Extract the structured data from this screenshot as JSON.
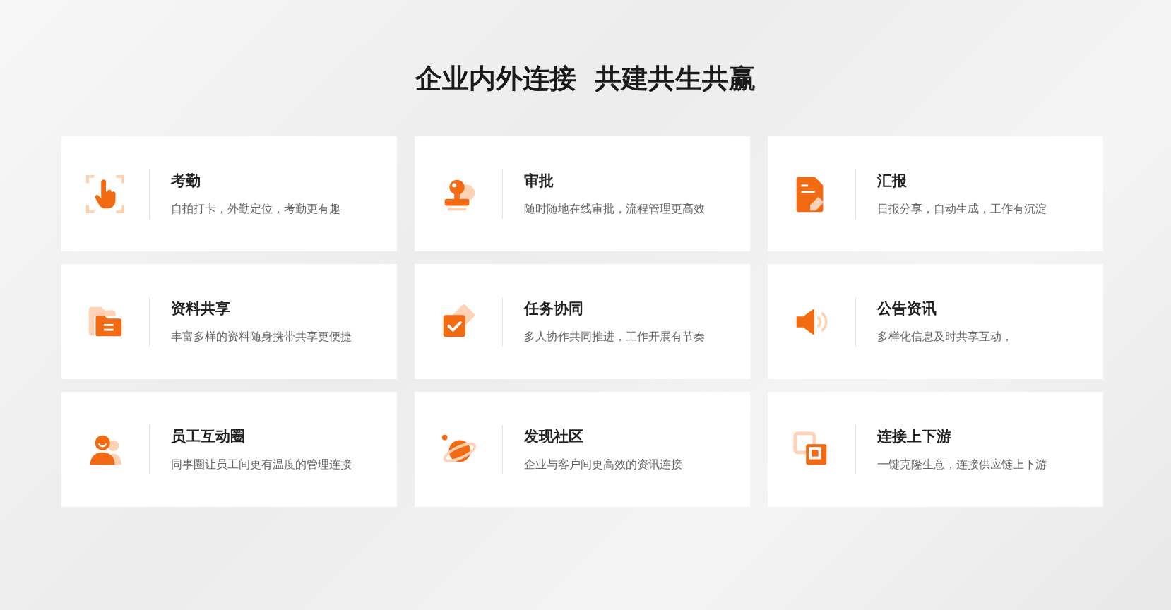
{
  "heading": "企业内外连接  共建共生共赢",
  "features": [
    {
      "kind": "hand",
      "title": "考勤",
      "description": "自拍打卡，外勤定位，考勤更有趣"
    },
    {
      "kind": "stamp",
      "title": "审批",
      "description": "随时随地在线审批，流程管理更高效"
    },
    {
      "kind": "report",
      "title": "汇报",
      "description": "日报分享，自动生成，工作有沉淀"
    },
    {
      "kind": "folder",
      "title": "资料共享",
      "description": "丰富多样的资料随身携带共享更便捷"
    },
    {
      "kind": "task",
      "title": "任务协同",
      "description": "多人协作共同推进，工作开展有节奏"
    },
    {
      "kind": "speaker",
      "title": "公告资讯",
      "description": "多样化信息及时共享互动，"
    },
    {
      "kind": "people",
      "title": "员工互动圈",
      "description": "同事圈让员工间更有温度的管理连接"
    },
    {
      "kind": "planet",
      "title": "发现社区",
      "description": "企业与客户间更高效的资讯连接"
    },
    {
      "kind": "link",
      "title": "连接上下游",
      "description": "一键克隆生意，连接供应链上下游"
    }
  ]
}
